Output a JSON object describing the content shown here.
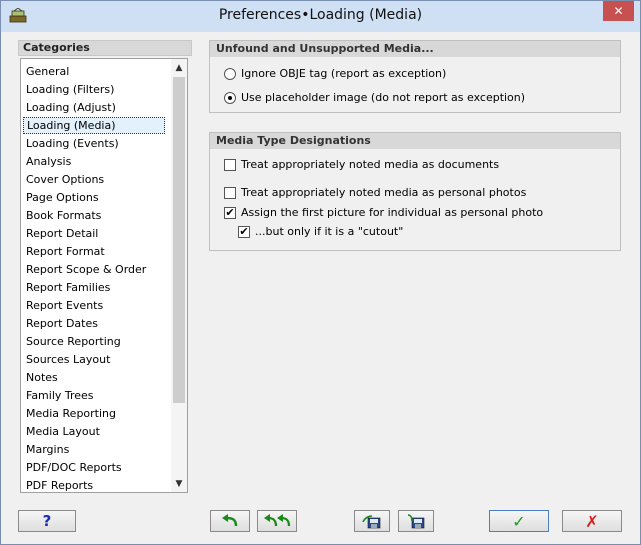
{
  "window": {
    "title": "Preferences•Loading (Media)",
    "close_glyph": "✕"
  },
  "categories": {
    "header": "Categories",
    "selected_index": 3,
    "items": [
      {
        "label": "General"
      },
      {
        "label": "Loading (Filters)"
      },
      {
        "label": "Loading (Adjust)"
      },
      {
        "label": "Loading (Media)"
      },
      {
        "label": "Loading (Events)"
      },
      {
        "label": "Analysis"
      },
      {
        "label": "Cover Options"
      },
      {
        "label": "Page Options"
      },
      {
        "label": "Book Formats"
      },
      {
        "label": "Report Detail"
      },
      {
        "label": "Report Format"
      },
      {
        "label": "Report Scope & Order"
      },
      {
        "label": "Report Families"
      },
      {
        "label": "Report Events"
      },
      {
        "label": "Report Dates"
      },
      {
        "label": "Source Reporting"
      },
      {
        "label": "Sources Layout"
      },
      {
        "label": "Notes"
      },
      {
        "label": "Family Trees"
      },
      {
        "label": "Media Reporting"
      },
      {
        "label": "Media Layout"
      },
      {
        "label": "Margins"
      },
      {
        "label": "PDF/DOC Reports"
      },
      {
        "label": "PDF Reports"
      }
    ],
    "scroll_up_glyph": "▲",
    "scroll_down_glyph": "▼"
  },
  "unfound_group": {
    "header": "Unfound and Unsupported Media...",
    "options": [
      {
        "label": "Ignore OBJE tag (report as exception)",
        "selected": false
      },
      {
        "label": "Use placeholder image (do not report as exception)",
        "selected": true
      }
    ]
  },
  "media_group": {
    "header": "Media Type Designations",
    "options": [
      {
        "label": "Treat appropriately noted media as documents",
        "checked": false
      },
      {
        "label": "Treat appropriately noted media as personal photos",
        "checked": false
      },
      {
        "label": "Assign the first picture for individual as personal photo",
        "checked": true
      },
      {
        "label": "...but only if it is a \"cutout\"",
        "checked": true
      }
    ]
  },
  "buttons": {
    "help": "?",
    "ok_glyph": "✓",
    "cancel_glyph": "✗"
  },
  "icons": {
    "app": "books-icon",
    "undo": "undo-arrow-icon",
    "undo_all": "double-undo-arrow-icon",
    "save": "floppy-save-icon",
    "load": "floppy-load-icon"
  },
  "colors": {
    "title_bar": "#cfe0f5",
    "close": "#c75050",
    "selection": "#e2f1fb",
    "ok": "#1a9a1a",
    "cancel": "#d42020",
    "help": "#1a2fb5"
  }
}
